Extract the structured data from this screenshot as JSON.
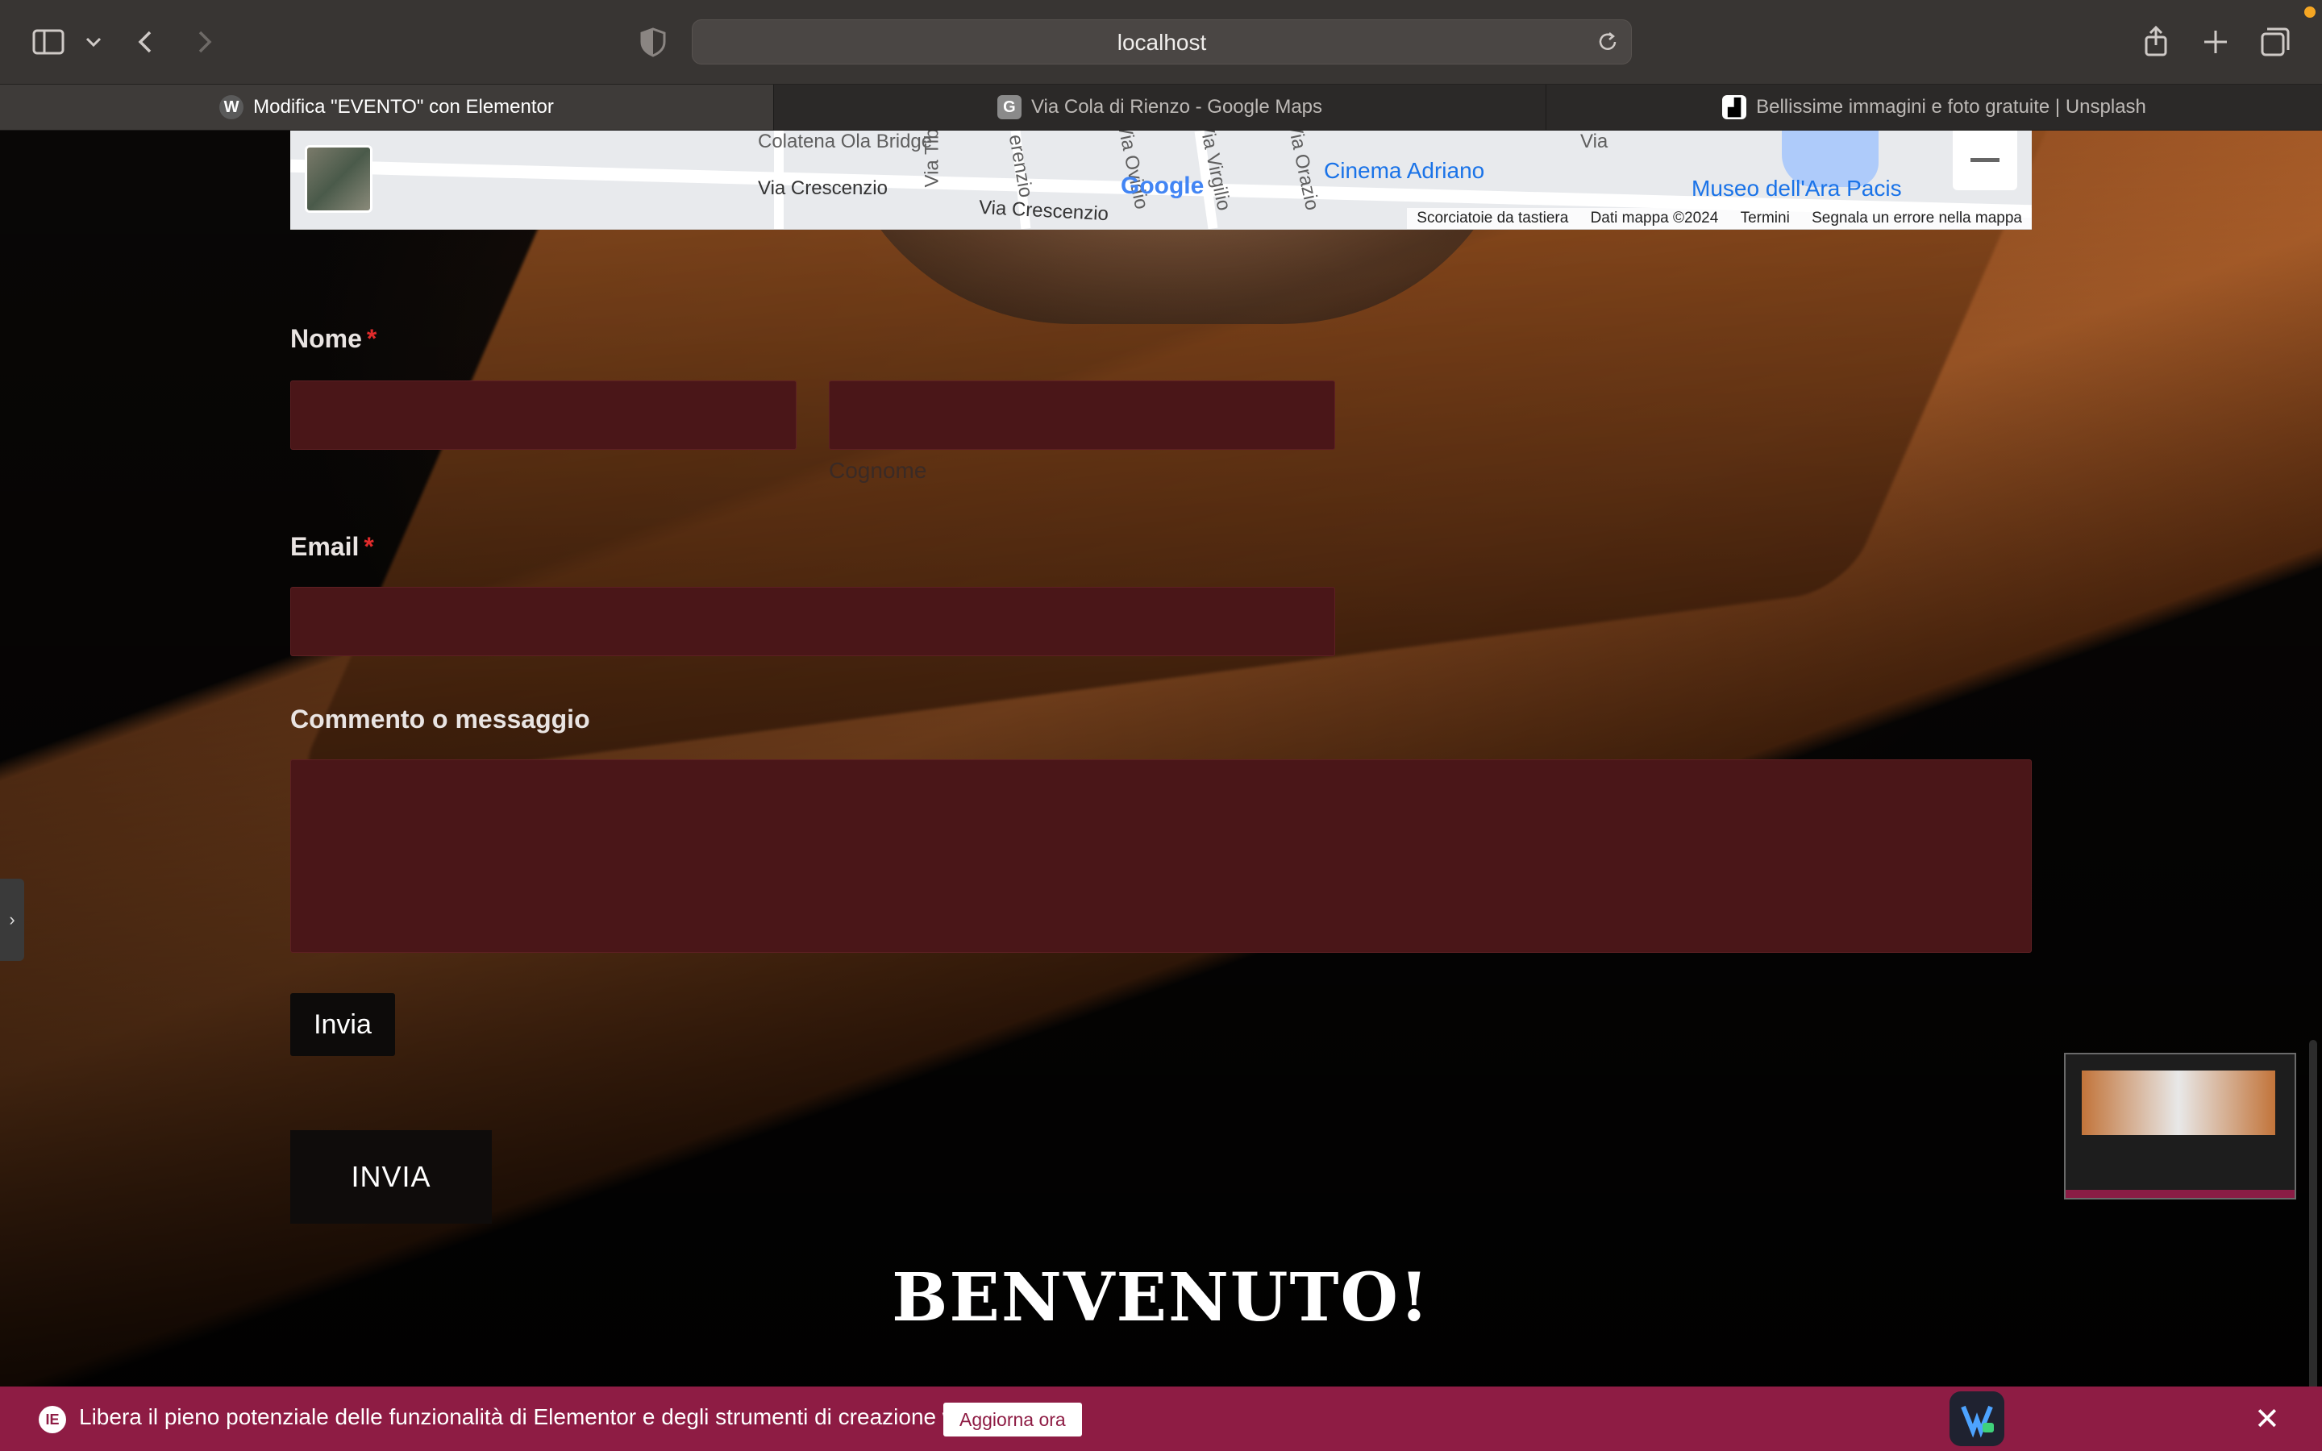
{
  "browser": {
    "url": "localhost",
    "tabs": [
      {
        "label": "Modifica \"EVENTO\" con Elementor",
        "active": true
      },
      {
        "label": "Via Cola di Rienzo - Google Maps",
        "active": false
      },
      {
        "label": "Bellissime immagini e foto gratuite | Unsplash",
        "active": false
      }
    ]
  },
  "map": {
    "street_labels": [
      "Via Crescenzio",
      "Via Crescenzio",
      "Via Tib",
      "erenzio",
      "Via Ovidio",
      "Via Virgilio",
      "Via Orazio",
      "Via"
    ],
    "poi_labels": [
      "Cinema Adriano",
      "Museo dell'Ara Pacis",
      "Colatena Ola Bridge"
    ],
    "logo": "Google",
    "attribution": [
      "Scorciatoie da tastiera",
      "Dati mappa ©2024",
      "Termini",
      "Segnala un errore nella mappa"
    ]
  },
  "form": {
    "name_label": "Nome",
    "required_mark": "*",
    "surname_sublabel": "Cognome",
    "email_label": "Email",
    "message_label": "Commento o messaggio",
    "submit_label": "Invia",
    "big_button_label": "INVIA"
  },
  "heading": "BENVENUTO!",
  "notice": {
    "message": "Libera il pieno potenziale delle funzionalità di Elementor e degli strumenti di creazione web.",
    "upgrade_label": "Aggiorna ora",
    "close": "✕",
    "elementor_badge": "IE"
  },
  "colors": {
    "field_bg": "#4a1618",
    "notice_bg": "#8e1c44",
    "required": "#e02b2b"
  }
}
